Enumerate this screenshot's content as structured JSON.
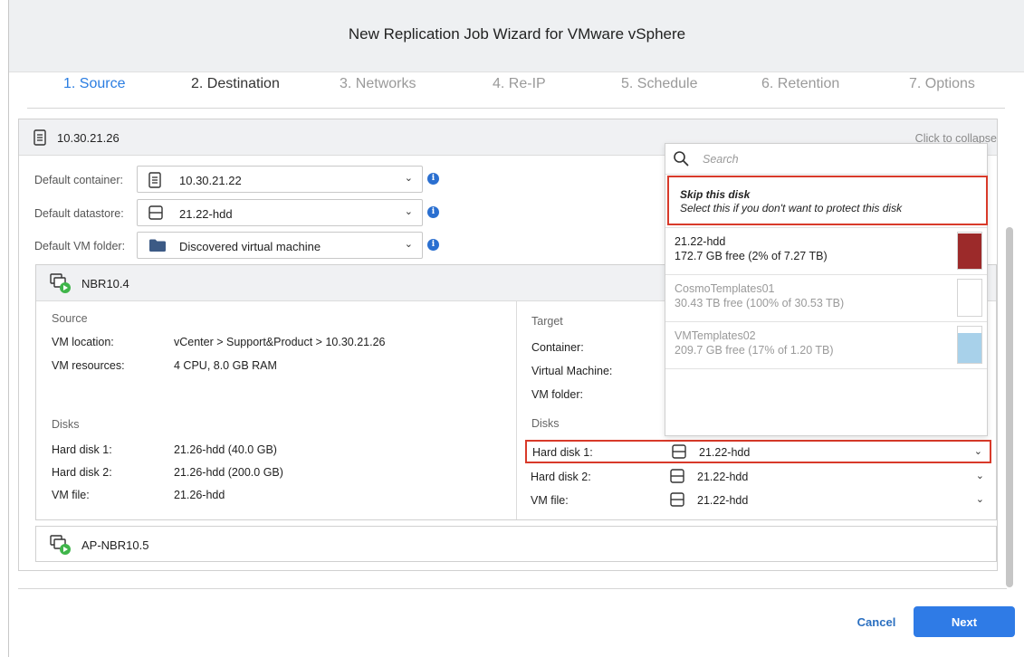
{
  "window": {
    "title": "New Replication Job Wizard for VMware vSphere"
  },
  "steps": [
    {
      "label": "1. Source",
      "state": "active"
    },
    {
      "label": "2. Destination",
      "state": "done"
    },
    {
      "label": "3. Networks",
      "state": "pending"
    },
    {
      "label": "4. Re-IP",
      "state": "pending"
    },
    {
      "label": "5. Schedule",
      "state": "pending"
    },
    {
      "label": "6. Retention",
      "state": "pending"
    },
    {
      "label": "7. Options",
      "state": "pending"
    }
  ],
  "host": {
    "name": "10.30.21.26",
    "collapse": "Click to collapse"
  },
  "defaults": {
    "container": {
      "label": "Default container:",
      "value": "10.30.21.22"
    },
    "datastore": {
      "label": "Default datastore:",
      "value": "21.22-hdd"
    },
    "folder": {
      "label": "Default VM folder:",
      "value": "Discovered virtual machine"
    }
  },
  "vm": {
    "name": "NBR10.4",
    "source": {
      "title": "Source",
      "location_label": "VM location:",
      "location_value": "vCenter > Support&Product > 10.30.21.26",
      "resources_label": "VM resources:",
      "resources_value": "4 CPU, 8.0 GB RAM",
      "disks_title": "Disks",
      "disks": [
        {
          "label": "Hard disk 1:",
          "value": "21.26-hdd (40.0 GB)"
        },
        {
          "label": "Hard disk 2:",
          "value": "21.26-hdd (200.0 GB)"
        },
        {
          "label": "VM file:",
          "value": "21.26-hdd"
        }
      ]
    },
    "target": {
      "title": "Target",
      "container_label": "Container:",
      "vm_label": "Virtual Machine:",
      "folder_label": "VM folder:",
      "disks_title": "Disks",
      "disks": [
        {
          "label": "Hard disk 1:",
          "value": "21.22-hdd"
        },
        {
          "label": "Hard disk 2:",
          "value": "21.22-hdd"
        },
        {
          "label": "VM file:",
          "value": "21.22-hdd"
        }
      ]
    }
  },
  "vm2": {
    "name": "AP-NBR10.5"
  },
  "dropdown": {
    "search_placeholder": "Search",
    "skip_title": "Skip this disk",
    "skip_desc": "Select this if you don't want to protect this disk",
    "items": [
      {
        "name": "21.22-hdd",
        "free": "172.7 GB free (2% of 7.27 TB)",
        "used_pct": 98,
        "color": "#9c2a2a",
        "enabled": true
      },
      {
        "name": "CosmoTemplates01",
        "free": "30.43 TB free (100% of 30.53 TB)",
        "used_pct": 0,
        "color": "#ffffff",
        "enabled": false
      },
      {
        "name": "VMTemplates02",
        "free": "209.7 GB free (17% of 1.20 TB)",
        "used_pct": 83,
        "color": "#a8d1ea",
        "enabled": false
      }
    ]
  },
  "footer": {
    "cancel": "Cancel",
    "next": "Next"
  },
  "colors": {
    "accent": "#2f7be6",
    "highlight": "#d83a2a",
    "vm_play": "#3fb54a"
  }
}
